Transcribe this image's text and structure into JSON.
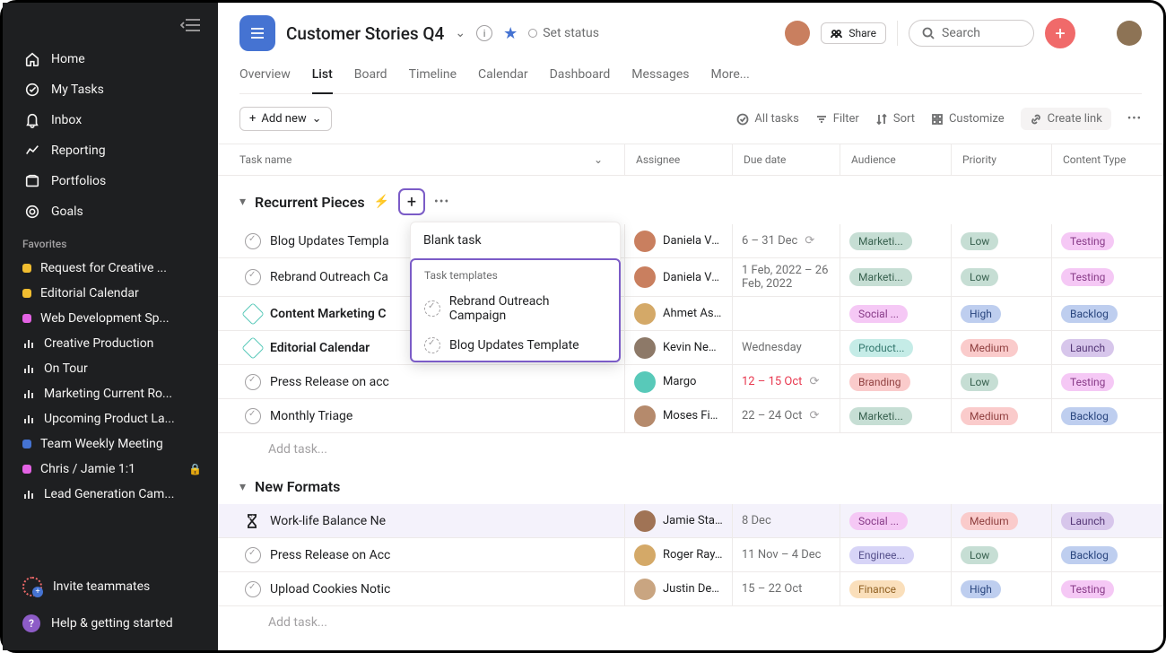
{
  "sidebar": {
    "nav": [
      {
        "label": "Home"
      },
      {
        "label": "My Tasks"
      },
      {
        "label": "Inbox"
      },
      {
        "label": "Reporting"
      },
      {
        "label": "Portfolios"
      },
      {
        "label": "Goals"
      }
    ],
    "favorites_heading": "Favorites",
    "favorites": [
      {
        "label": "Request for Creative ...",
        "color": "#f1bd30",
        "type": "dot"
      },
      {
        "label": "Editorial Calendar",
        "color": "#f1bd30",
        "type": "dot"
      },
      {
        "label": "Web Development Sp...",
        "color": "#e362e3",
        "type": "dot"
      },
      {
        "label": "Creative Production",
        "type": "bars"
      },
      {
        "label": "On Tour",
        "type": "bars"
      },
      {
        "label": "Marketing Current Ro...",
        "type": "bars"
      },
      {
        "label": "Upcoming Product La...",
        "type": "bars"
      },
      {
        "label": "Team Weekly Meeting",
        "color": "#4573d2",
        "type": "dot"
      },
      {
        "label": "Chris / Jamie 1:1",
        "color": "#e362e3",
        "type": "dot",
        "locked": true
      },
      {
        "label": "Lead Generation Cam...",
        "type": "bars"
      }
    ],
    "invite": "Invite teammates",
    "help": "Help & getting started"
  },
  "header": {
    "title": "Customer Stories Q4",
    "status": "Set status",
    "share": "Share",
    "search_placeholder": "Search"
  },
  "tabs": [
    "Overview",
    "List",
    "Board",
    "Timeline",
    "Calendar",
    "Dashboard",
    "Messages",
    "More..."
  ],
  "active_tab": "List",
  "toolbar": {
    "add_new": "Add new",
    "all_tasks": "All tasks",
    "filter": "Filter",
    "sort": "Sort",
    "customize": "Customize",
    "create_link": "Create link"
  },
  "columns": {
    "task": "Task name",
    "assignee": "Assignee",
    "due": "Due date",
    "audience": "Audience",
    "priority": "Priority",
    "content": "Content Type"
  },
  "dropdown": {
    "blank": "Blank task",
    "templates_heading": "Task templates",
    "templates": [
      "Rebrand Outreach Campaign",
      "Blog Updates Template"
    ]
  },
  "colors": {
    "marketing": "#5da283",
    "social": "#e362e3",
    "product": "#58c9b9",
    "branding": "#f06a6a",
    "engineering": "#8d84e8",
    "finance": "#f1a33c",
    "low": "#5da283",
    "high": "#4573d2",
    "medium": "#f06a6a",
    "testing": "#e362e3",
    "backlog": "#4573d2",
    "launch": "#8d5cc7"
  },
  "sections": [
    {
      "title": "Recurrent Pieces",
      "has_bolt": true,
      "has_plus": true,
      "tasks": [
        {
          "name": "Blog Updates Templa",
          "assignee": "Daniela Var...",
          "av": "#c97f5f",
          "due": "6 – 31 Dec",
          "recur": true,
          "audience": "Marketi...",
          "aud_color": "marketing",
          "priority": "Low",
          "pri_color": "low",
          "content": "Testing",
          "con_color": "testing"
        },
        {
          "name": "Rebrand Outreach Ca",
          "assignee": "Daniela Var...",
          "av": "#c97f5f",
          "due": "1 Feb, 2022 – 26 Feb, 2022",
          "audience": "Marketi...",
          "aud_color": "marketing",
          "priority": "Low",
          "pri_color": "low",
          "content": "Testing",
          "con_color": "testing"
        },
        {
          "name": "Content Marketing C",
          "bold": true,
          "milestone": true,
          "assignee": "Ahmet Aslan",
          "av": "#d4a968",
          "due": "",
          "audience": "Social ...",
          "aud_color": "social",
          "priority": "High",
          "pri_color": "high",
          "content": "Backlog",
          "con_color": "backlog"
        },
        {
          "name": "Editorial Calendar",
          "bold": true,
          "milestone": true,
          "assignee": "Kevin New...",
          "av": "#8d7968",
          "due": "Wednesday",
          "audience": "Product...",
          "aud_color": "product",
          "priority": "Medium",
          "pri_color": "medium",
          "content": "Launch",
          "con_color": "launch"
        },
        {
          "name": "Press Release on acc",
          "assignee": "Margo",
          "av": "#58c9b9",
          "due": "12 – 15 Oct",
          "due_red": true,
          "recur": true,
          "audience": "Branding",
          "aud_color": "branding",
          "priority": "Low",
          "pri_color": "low",
          "content": "Testing",
          "con_color": "testing"
        },
        {
          "name": "Monthly Triage",
          "assignee": "Moses Fidel",
          "av": "#b58a6c",
          "due": "22 – 24 Oct",
          "recur": true,
          "audience": "Marketi...",
          "aud_color": "marketing",
          "priority": "Medium",
          "pri_color": "medium",
          "content": "Backlog",
          "con_color": "backlog"
        }
      ],
      "add_task": "Add task..."
    },
    {
      "title": "New Formats",
      "tasks": [
        {
          "name": "Work-life Balance Ne",
          "hourglass": true,
          "highlighted": true,
          "assignee": "Jamie Stap...",
          "av": "#a07355",
          "due": "8 Dec",
          "audience": "Social ...",
          "aud_color": "social",
          "priority": "Medium",
          "pri_color": "medium",
          "content": "Launch",
          "con_color": "launch"
        },
        {
          "name": "Press Release on Acc",
          "assignee": "Roger Ray...",
          "av": "#d4a968",
          "due": "11 Nov – 4 Dec",
          "audience": "Enginee...",
          "aud_color": "engineering",
          "priority": "Low",
          "pri_color": "low",
          "content": "Backlog",
          "con_color": "backlog"
        },
        {
          "name": "Upload Cookies Notic",
          "assignee": "Justin Dean",
          "av": "#c9a581",
          "due": "15 – 22 Oct",
          "audience": "Finance",
          "aud_color": "finance",
          "priority": "High",
          "pri_color": "high",
          "content": "Testing",
          "con_color": "testing"
        }
      ],
      "add_task": "Add task..."
    }
  ]
}
